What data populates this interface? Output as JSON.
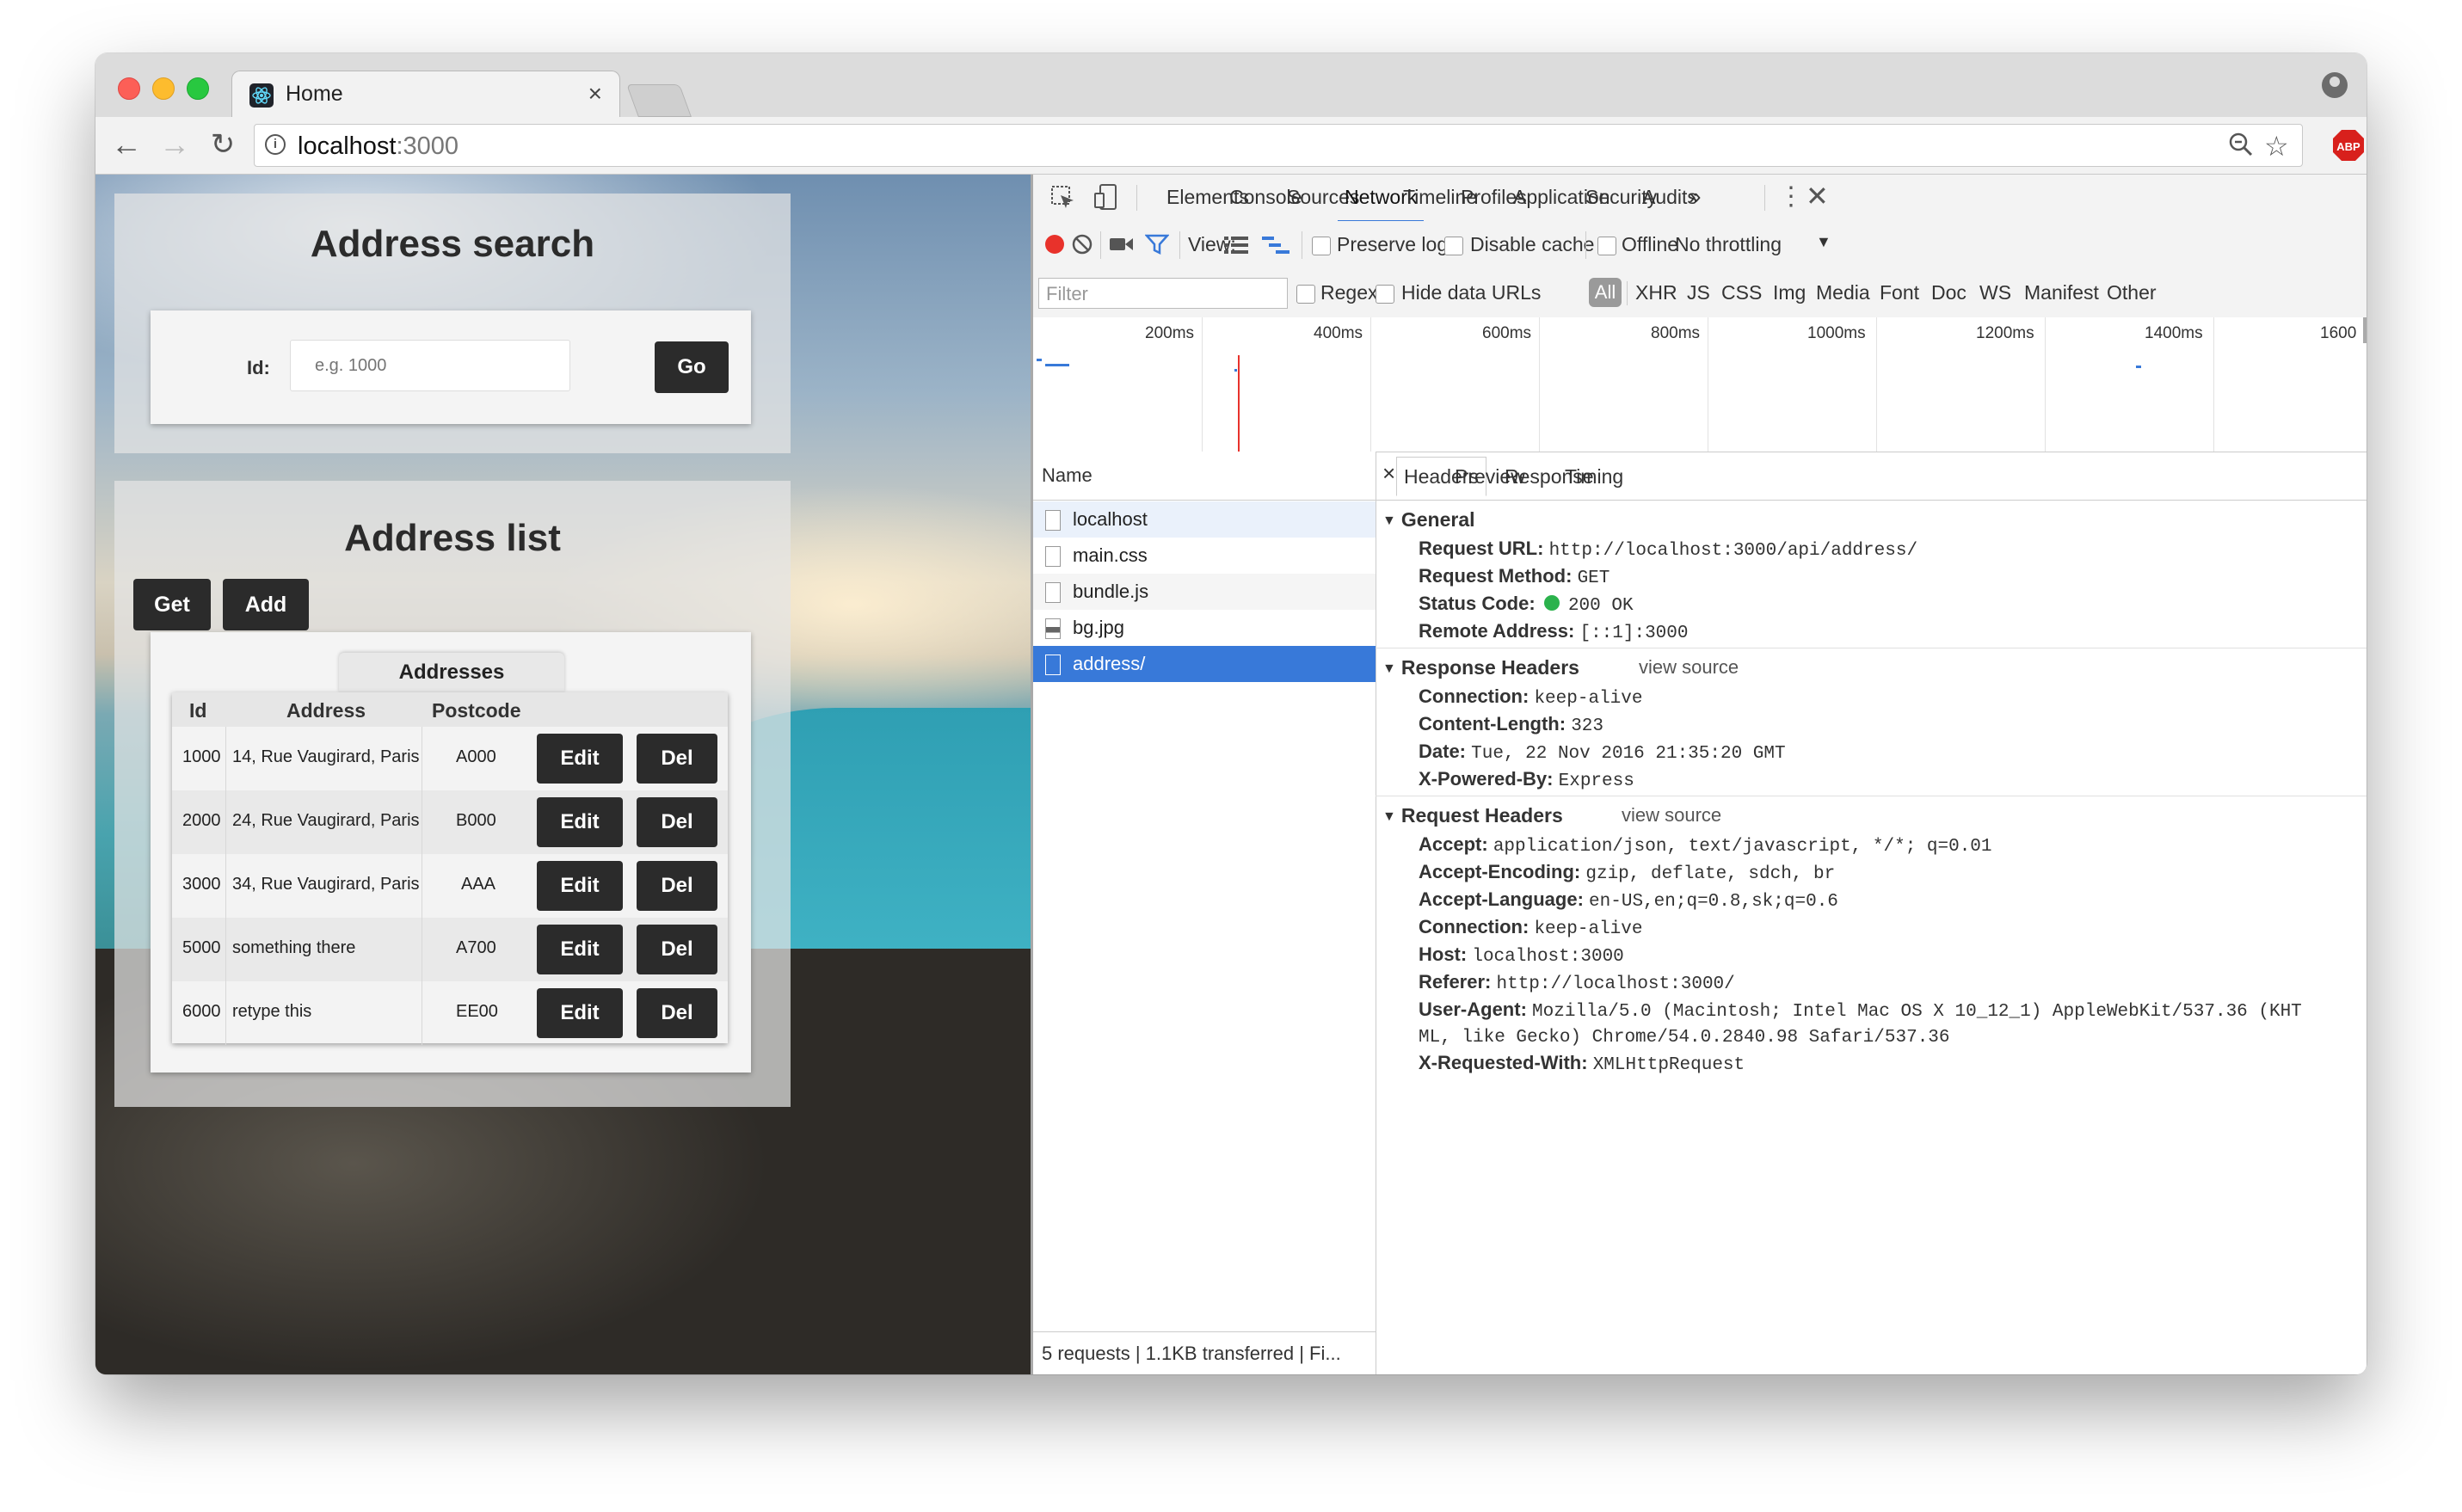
{
  "browser": {
    "tab_title": "Home",
    "tab_close": "×",
    "url_host": "localhost",
    "url_port": ":3000"
  },
  "app": {
    "search": {
      "title": "Address search",
      "id_label": "Id:",
      "id_placeholder": "e.g. 1000",
      "go_label": "Go"
    },
    "list": {
      "title": "Address list",
      "get_label": "Get",
      "add_label": "Add",
      "table_tab": "Addresses",
      "columns": [
        "Id",
        "Address",
        "Postcode"
      ],
      "edit_label": "Edit",
      "del_label": "Del",
      "rows": [
        {
          "id": "1000",
          "address": "14, Rue Vaugirard, Paris",
          "postcode": "A000"
        },
        {
          "id": "2000",
          "address": "24, Rue Vaugirard, Paris",
          "postcode": "B000"
        },
        {
          "id": "3000",
          "address": "34, Rue Vaugirard, Paris",
          "postcode": "AAA"
        },
        {
          "id": "5000",
          "address": "something there",
          "postcode": "A700"
        },
        {
          "id": "6000",
          "address": "retype this",
          "postcode": "EE00"
        }
      ]
    }
  },
  "devtools": {
    "tabs": [
      "Elements",
      "Console",
      "Sources",
      "Network",
      "Timeline",
      "Profiles",
      "Application",
      "Security",
      "Audits"
    ],
    "more_tabs": "»",
    "active_tab": "Network",
    "view_label": "View:",
    "preserve_log": "Preserve log",
    "disable_cache": "Disable cache",
    "offline": "Offline",
    "throttling": "No throttling",
    "filter_placeholder": "Filter",
    "regex": "Regex",
    "hide_data_urls": "Hide data URLs",
    "type_filters": [
      "All",
      "XHR",
      "JS",
      "CSS",
      "Img",
      "Media",
      "Font",
      "Doc",
      "WS",
      "Manifest",
      "Other"
    ],
    "timeline_ticks": [
      "200ms",
      "400ms",
      "600ms",
      "800ms",
      "1000ms",
      "1200ms",
      "1400ms",
      "1600"
    ],
    "name_header": "Name",
    "requests": [
      "localhost",
      "main.css",
      "bundle.js",
      "bg.jpg",
      "address/"
    ],
    "selected_request": "address/",
    "status_bar": "5 requests | 1.1KB transferred | Fi...",
    "detail_tabs": [
      "Headers",
      "Preview",
      "Response",
      "Timing"
    ],
    "detail_close": "×",
    "general": {
      "title": "General",
      "items": [
        {
          "k": "Request URL:",
          "v": "http://localhost:3000/api/address/"
        },
        {
          "k": "Request Method:",
          "v": "GET"
        },
        {
          "k": "Status Code:",
          "v": "200 OK"
        },
        {
          "k": "Remote Address:",
          "v": "[::1]:3000"
        }
      ]
    },
    "response_headers": {
      "title": "Response Headers",
      "view_source": "view source",
      "items": [
        {
          "k": "Connection:",
          "v": "keep-alive"
        },
        {
          "k": "Content-Length:",
          "v": "323"
        },
        {
          "k": "Date:",
          "v": "Tue, 22 Nov 2016 21:35:20 GMT"
        },
        {
          "k": "X-Powered-By:",
          "v": "Express"
        }
      ]
    },
    "request_headers": {
      "title": "Request Headers",
      "view_source": "view source",
      "items": [
        {
          "k": "Accept:",
          "v": "application/json, text/javascript, */*; q=0.01"
        },
        {
          "k": "Accept-Encoding:",
          "v": "gzip, deflate, sdch, br"
        },
        {
          "k": "Accept-Language:",
          "v": "en-US,en;q=0.8,sk;q=0.6"
        },
        {
          "k": "Connection:",
          "v": "keep-alive"
        },
        {
          "k": "Host:",
          "v": "localhost:3000"
        },
        {
          "k": "Referer:",
          "v": "http://localhost:3000/"
        },
        {
          "k": "User-Agent:",
          "v": "Mozilla/5.0 (Macintosh; Intel Mac OS X 10_12_1) AppleWebKit/537.36 (KHT"
        },
        {
          "k": "",
          "v": "ML, like Gecko) Chrome/54.0.2840.98 Safari/537.36"
        },
        {
          "k": "X-Requested-With:",
          "v": "XMLHttpRequest"
        }
      ]
    }
  },
  "colors": {
    "accent": "#3879d9",
    "record": "#e8322b",
    "status_ok": "#2bb24c"
  }
}
